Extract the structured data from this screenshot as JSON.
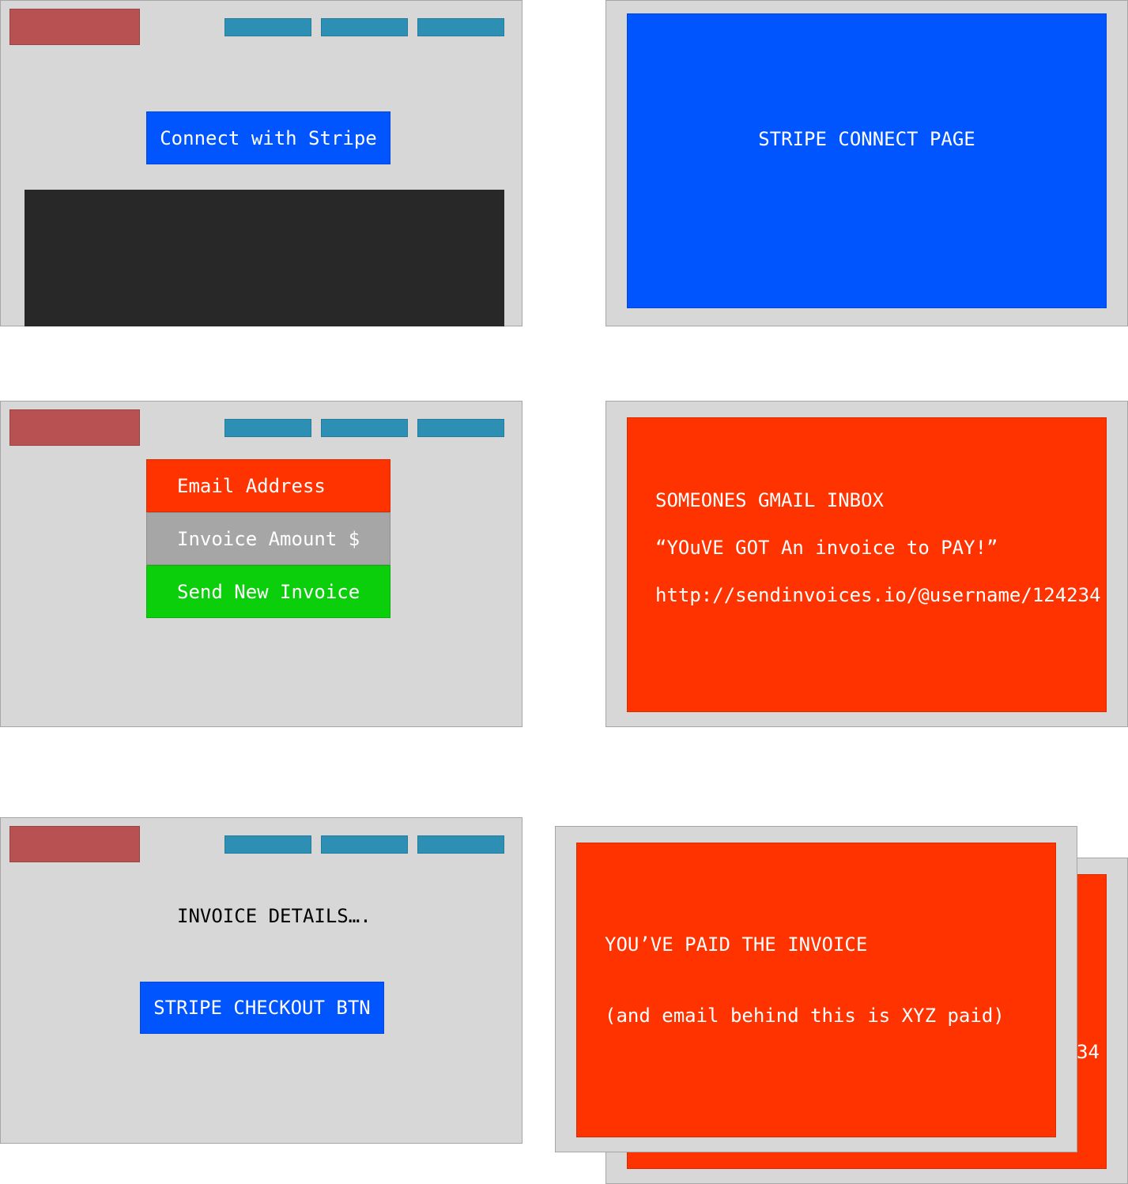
{
  "colors": {
    "panel_bg": "#d7d7d7",
    "logo": "#b85252",
    "nav_button": "#2e8fb4",
    "stripe_blue": "#0055ff",
    "email_red": "#ff3300",
    "input_gray": "#a6a6a6",
    "send_green": "#0ccf0c",
    "dark_block": "#282828"
  },
  "screen1": {
    "connect_button": "Connect with Stripe"
  },
  "screen2": {
    "title": "STRIPE CONNECT PAGE"
  },
  "screen3": {
    "email_field": "Email Address",
    "amount_field": "Invoice Amount $",
    "send_button": "Send New Invoice"
  },
  "screen4": {
    "heading": "SOMEONES GMAIL INBOX",
    "subject": "“YOuVE GOT An invoice to PAY!”",
    "link": "http://sendinvoices.io/@username/124234"
  },
  "screen5": {
    "details": "INVOICE DETAILS….",
    "checkout_button": "STRIPE CHECKOUT BTN"
  },
  "screen6": {
    "back_card_fragment": "34",
    "paid_title": "YOU’VE PAID THE INVOICE",
    "paid_note": "(and email behind this is XYZ paid)"
  }
}
